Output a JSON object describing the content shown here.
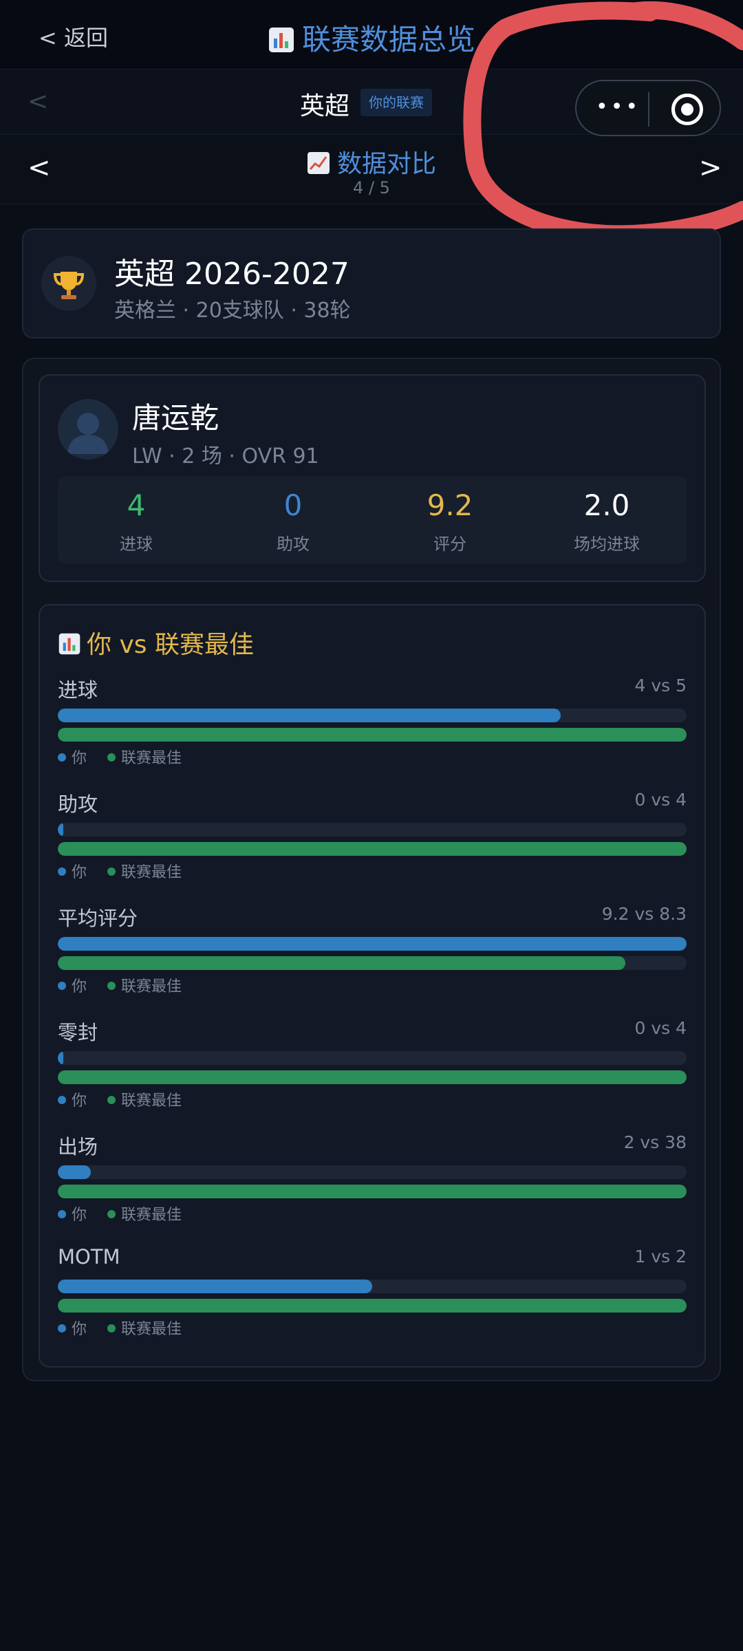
{
  "nav": {
    "back_label": "< 返回",
    "title": "联赛数据总览"
  },
  "league_switch": {
    "prev": "<",
    "name": "英超",
    "badge": "你的联赛",
    "next": ">"
  },
  "capsule": {
    "more": "•••"
  },
  "section": {
    "prev": "<",
    "title": "数据对比",
    "page": "4 / 5",
    "next": ">"
  },
  "league_card": {
    "title": "英超 2026-2027",
    "subtitle": "英格兰 · 20支球队 · 38轮"
  },
  "player": {
    "name": "唐运乾",
    "meta": "LW · 2 场 · OVR 91",
    "stats": [
      {
        "value": "4",
        "label": "进球",
        "color": "#3dbb6e"
      },
      {
        "value": "0",
        "label": "助攻",
        "color": "#3d86d2"
      },
      {
        "value": "9.2",
        "label": "评分",
        "color": "#e3b84a"
      },
      {
        "value": "2.0",
        "label": "场均进球",
        "color": "#ffffff"
      }
    ]
  },
  "compare": {
    "title": "你 vs 联赛最佳",
    "legend_you": "你",
    "legend_best": "联赛最佳",
    "colors": {
      "you": "#2f7fc1",
      "best": "#2a8f58"
    },
    "metrics": [
      {
        "label": "进球",
        "value_text": "4 vs 5",
        "you": 4,
        "best": 5
      },
      {
        "label": "助攻",
        "value_text": "0 vs 4",
        "you": 0,
        "best": 4
      },
      {
        "label": "平均评分",
        "value_text": "9.2 vs 8.3",
        "you": 9.2,
        "best": 8.3
      },
      {
        "label": "零封",
        "value_text": "0 vs 4",
        "you": 0,
        "best": 4
      },
      {
        "label": "出场",
        "value_text": "2 vs 38",
        "you": 2,
        "best": 38
      },
      {
        "label": "MOTM",
        "value_text": "1 vs 2",
        "you": 1,
        "best": 2
      }
    ]
  }
}
